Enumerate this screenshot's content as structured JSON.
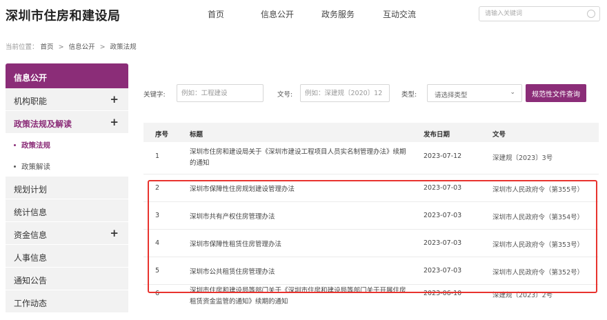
{
  "header": {
    "site_title": "深圳市住房和建设局",
    "nav": [
      "首页",
      "信息公开",
      "政务服务",
      "互动交流"
    ],
    "search_placeholder": "请输入关键词"
  },
  "breadcrumb": {
    "prefix": "当前位置：",
    "items": [
      "首页",
      "信息公开",
      "政策法规"
    ],
    "separator": ">"
  },
  "sidebar": {
    "heading": "信息公开",
    "items": [
      {
        "label": "机构职能",
        "expand": "+"
      },
      {
        "label": "政策法规及解读",
        "expand": "+"
      },
      {
        "label": "政策法规"
      },
      {
        "label": "政策解读"
      },
      {
        "label": "规划计划"
      },
      {
        "label": "统计信息"
      },
      {
        "label": "资金信息",
        "expand": "+"
      },
      {
        "label": "人事信息"
      },
      {
        "label": "通知公告"
      },
      {
        "label": "工作动态"
      }
    ]
  },
  "filters": {
    "keyword_label": "关键字:",
    "keyword_placeholder": "例如：工程建设",
    "docno_label": "文号:",
    "docno_placeholder": "例如：深建规〔2020〕12",
    "type_label": "类型:",
    "type_value": "请选择类型",
    "query_button": "规范性文件查询"
  },
  "table": {
    "headers": [
      "序号",
      "标题",
      "发布日期",
      "文号"
    ],
    "rows": [
      {
        "seq": "1",
        "title": "深圳市住房和建设局关于《深圳市建设工程项目人员实名制管理办法》续期的通知",
        "date": "2023-07-12",
        "doc": "深建规〔2023〕3号"
      },
      {
        "seq": "2",
        "title": "深圳市保障性住房规划建设管理办法",
        "date": "2023-07-03",
        "doc": "深圳市人民政府令（第355号）"
      },
      {
        "seq": "3",
        "title": "深圳市共有产权住房管理办法",
        "date": "2023-07-03",
        "doc": "深圳市人民政府令（第354号）"
      },
      {
        "seq": "4",
        "title": "深圳市保障性租赁住房管理办法",
        "date": "2023-07-03",
        "doc": "深圳市人民政府令（第353号）"
      },
      {
        "seq": "5",
        "title": "深圳市公共租赁住房管理办法",
        "date": "2023-07-03",
        "doc": "深圳市人民政府令（第352号）"
      },
      {
        "seq": "6",
        "title": "深圳市住房和建设局等部门关于《深圳市住房和建设局等部门关于开展住房租赁资金监管的通知》续期的通知",
        "date": "2023-06-10",
        "doc": "深建规〔2023〕2号"
      }
    ]
  },
  "colors": {
    "accent": "#8b2d78",
    "highlight_box": "#e8322d"
  },
  "icons": {
    "search": "search-icon",
    "expand": "plus-icon",
    "dropdown": "chevron-down-icon"
  }
}
